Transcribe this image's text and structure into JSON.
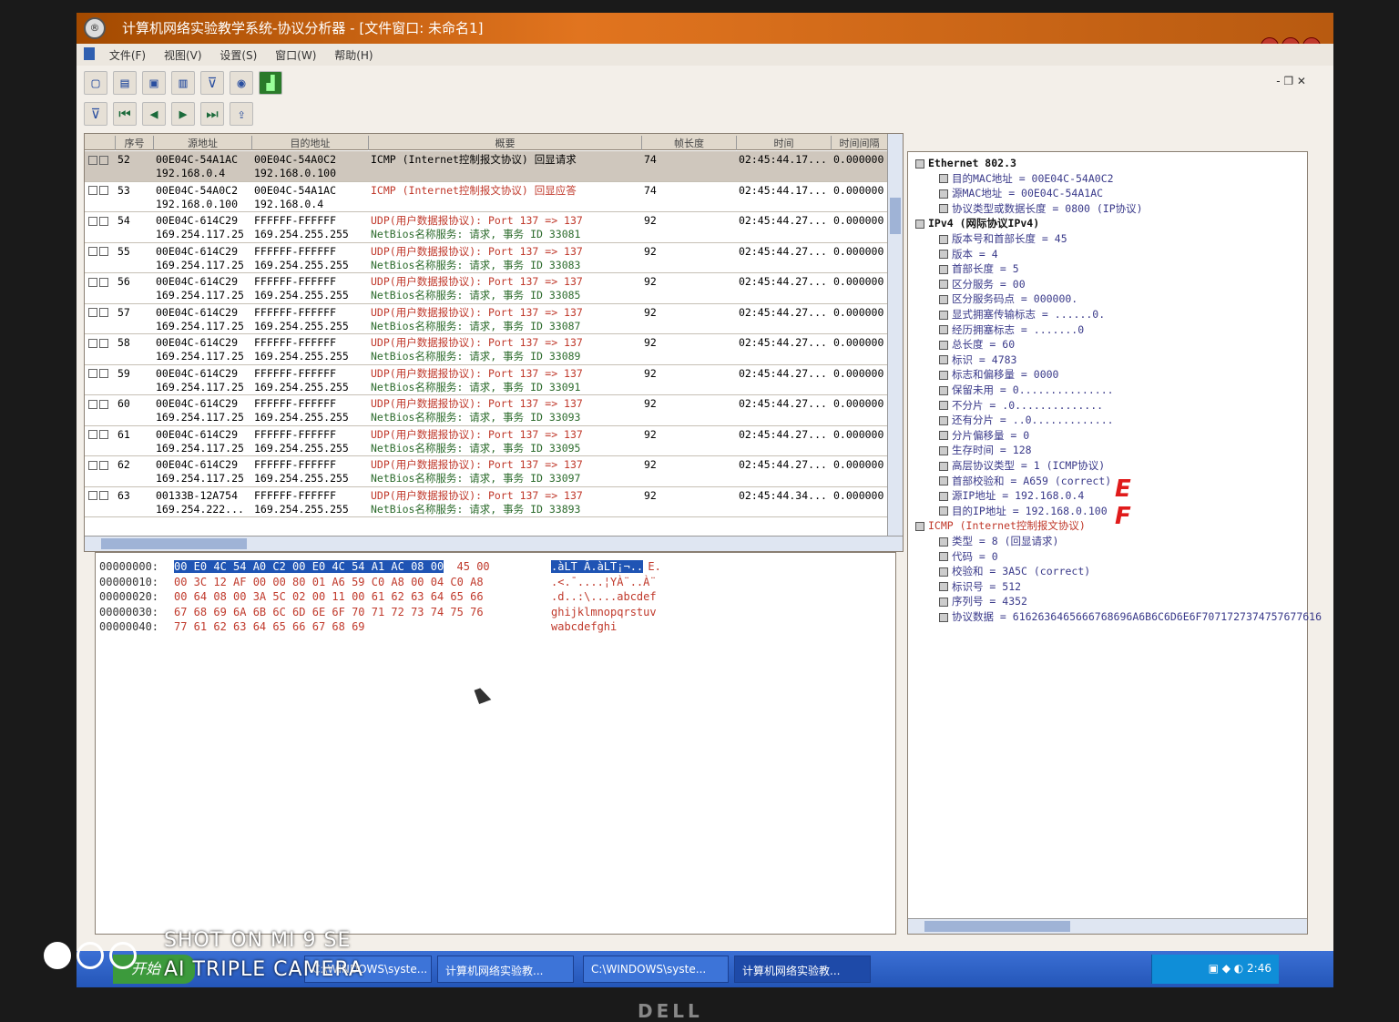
{
  "window": {
    "title": "计算机网络实验教学系统-协议分析器 - [文件窗口: 未命名1]"
  },
  "menu": [
    "文件(F)",
    "视图(V)",
    "设置(S)",
    "窗口(W)",
    "帮助(H)"
  ],
  "packet_list": {
    "columns": [
      "序号",
      "源地址",
      "目的地址",
      "概要",
      "帧长度",
      "时间",
      "时间间隔"
    ],
    "rows": [
      {
        "no": "52",
        "src1": "00E04C-54A1AC",
        "src2": "192.168.0.4",
        "dst1": "00E04C-54A0C2",
        "dst2": "192.168.0.100",
        "sum1": "ICMP (Internet控制报文协议) 回显请求",
        "sum2": "",
        "len": "74",
        "time": "02:45:44.17...",
        "gap": "0.000000"
      },
      {
        "no": "53",
        "src1": "00E04C-54A0C2",
        "src2": "192.168.0.100",
        "dst1": "00E04C-54A1AC",
        "dst2": "192.168.0.4",
        "sum1": "ICMP (Internet控制报文协议) 回显应答",
        "sum2": "",
        "len": "74",
        "time": "02:45:44.17...",
        "gap": "0.000000"
      },
      {
        "no": "54",
        "src1": "00E04C-614C29",
        "src2": "169.254.117.25",
        "dst1": "FFFFFF-FFFFFF",
        "dst2": "169.254.255.255",
        "sum1": "UDP(用户数据报协议): Port 137 => 137",
        "sum2": "NetBios名称服务: 请求, 事务 ID 33081",
        "len": "92",
        "time": "02:45:44.27...",
        "gap": "0.000000"
      },
      {
        "no": "55",
        "src1": "00E04C-614C29",
        "src2": "169.254.117.25",
        "dst1": "FFFFFF-FFFFFF",
        "dst2": "169.254.255.255",
        "sum1": "UDP(用户数据报协议): Port 137 => 137",
        "sum2": "NetBios名称服务: 请求, 事务 ID 33083",
        "len": "92",
        "time": "02:45:44.27...",
        "gap": "0.000000"
      },
      {
        "no": "56",
        "src1": "00E04C-614C29",
        "src2": "169.254.117.25",
        "dst1": "FFFFFF-FFFFFF",
        "dst2": "169.254.255.255",
        "sum1": "UDP(用户数据报协议): Port 137 => 137",
        "sum2": "NetBios名称服务: 请求, 事务 ID 33085",
        "len": "92",
        "time": "02:45:44.27...",
        "gap": "0.000000"
      },
      {
        "no": "57",
        "src1": "00E04C-614C29",
        "src2": "169.254.117.25",
        "dst1": "FFFFFF-FFFFFF",
        "dst2": "169.254.255.255",
        "sum1": "UDP(用户数据报协议): Port 137 => 137",
        "sum2": "NetBios名称服务: 请求, 事务 ID 33087",
        "len": "92",
        "time": "02:45:44.27...",
        "gap": "0.000000"
      },
      {
        "no": "58",
        "src1": "00E04C-614C29",
        "src2": "169.254.117.25",
        "dst1": "FFFFFF-FFFFFF",
        "dst2": "169.254.255.255",
        "sum1": "UDP(用户数据报协议): Port 137 => 137",
        "sum2": "NetBios名称服务: 请求, 事务 ID 33089",
        "len": "92",
        "time": "02:45:44.27...",
        "gap": "0.000000"
      },
      {
        "no": "59",
        "src1": "00E04C-614C29",
        "src2": "169.254.117.25",
        "dst1": "FFFFFF-FFFFFF",
        "dst2": "169.254.255.255",
        "sum1": "UDP(用户数据报协议): Port 137 => 137",
        "sum2": "NetBios名称服务: 请求, 事务 ID 33091",
        "len": "92",
        "time": "02:45:44.27...",
        "gap": "0.000000"
      },
      {
        "no": "60",
        "src1": "00E04C-614C29",
        "src2": "169.254.117.25",
        "dst1": "FFFFFF-FFFFFF",
        "dst2": "169.254.255.255",
        "sum1": "UDP(用户数据报协议): Port 137 => 137",
        "sum2": "NetBios名称服务: 请求, 事务 ID 33093",
        "len": "92",
        "time": "02:45:44.27...",
        "gap": "0.000000"
      },
      {
        "no": "61",
        "src1": "00E04C-614C29",
        "src2": "169.254.117.25",
        "dst1": "FFFFFF-FFFFFF",
        "dst2": "169.254.255.255",
        "sum1": "UDP(用户数据报协议): Port 137 => 137",
        "sum2": "NetBios名称服务: 请求, 事务 ID 33095",
        "len": "92",
        "time": "02:45:44.27...",
        "gap": "0.000000"
      },
      {
        "no": "62",
        "src1": "00E04C-614C29",
        "src2": "169.254.117.25",
        "dst1": "FFFFFF-FFFFFF",
        "dst2": "169.254.255.255",
        "sum1": "UDP(用户数据报协议): Port 137 => 137",
        "sum2": "NetBios名称服务: 请求, 事务 ID 33097",
        "len": "92",
        "time": "02:45:44.27...",
        "gap": "0.000000"
      },
      {
        "no": "63",
        "src1": "00133B-12A754",
        "src2": "169.254.222...",
        "dst1": "FFFFFF-FFFFFF",
        "dst2": "169.254.255.255",
        "sum1": "UDP(用户数据报协议): Port 137 => 137",
        "sum2": "NetBios名称服务: 请求, 事务 ID 33893",
        "len": "92",
        "time": "02:45:44.34...",
        "gap": "0.000000"
      }
    ]
  },
  "tree": [
    {
      "text": "Ethernet 802.3",
      "kind": "head"
    },
    {
      "text": "目的MAC地址 = 00E04C-54A0C2",
      "kind": "leaf"
    },
    {
      "text": "源MAC地址 = 00E04C-54A1AC",
      "kind": "leaf"
    },
    {
      "text": "协议类型或数据长度 = 0800 (IP协议)",
      "kind": "leaf"
    },
    {
      "text": "IPv4 (网际协议IPv4)",
      "kind": "head"
    },
    {
      "text": "版本号和首部长度 = 45",
      "kind": "leaf"
    },
    {
      "text": "版本 = 4",
      "kind": "leaf"
    },
    {
      "text": "首部长度 = 5",
      "kind": "leaf"
    },
    {
      "text": "区分服务 = 00",
      "kind": "leaf"
    },
    {
      "text": "区分服务码点 = 000000.",
      "kind": "leaf"
    },
    {
      "text": "显式拥塞传输标志 = ......0.",
      "kind": "leaf"
    },
    {
      "text": "经历拥塞标志 = .......0",
      "kind": "leaf"
    },
    {
      "text": "总长度 = 60",
      "kind": "leaf"
    },
    {
      "text": "标识 = 4783",
      "kind": "leaf"
    },
    {
      "text": "标志和偏移量 = 0000",
      "kind": "leaf"
    },
    {
      "text": "保留未用 = 0...............",
      "kind": "leaf"
    },
    {
      "text": "不分片 = .0..............",
      "kind": "leaf"
    },
    {
      "text": "还有分片 = ..0.............",
      "kind": "leaf"
    },
    {
      "text": "分片偏移量 = 0",
      "kind": "leaf"
    },
    {
      "text": "生存时间 = 128",
      "kind": "leaf"
    },
    {
      "text": "高层协议类型 = 1 (ICMP协议)",
      "kind": "leaf"
    },
    {
      "text": "首部校验和 = A659 (correct)",
      "kind": "leaf"
    },
    {
      "text": "源IP地址 = 192.168.0.4",
      "kind": "leaf"
    },
    {
      "text": "目的IP地址 = 192.168.0.100",
      "kind": "leaf"
    },
    {
      "text": "ICMP (Internet控制报文协议)",
      "kind": "icmp"
    },
    {
      "text": "类型 = 8 (回显请求)",
      "kind": "leaf"
    },
    {
      "text": "代码 = 0",
      "kind": "leaf"
    },
    {
      "text": "校验和 = 3A5C (correct)",
      "kind": "leaf"
    },
    {
      "text": "标识号 = 512",
      "kind": "leaf"
    },
    {
      "text": "序列号 = 4352",
      "kind": "leaf"
    },
    {
      "text": "协议数据 = 6162636465666768696A6B6C6D6E6F7071727374757677616",
      "kind": "leaf"
    }
  ],
  "hex": [
    {
      "off": "00000000:",
      "sel": "00 E0 4C 54 A0 C2 00 E0 4C 54 A1 AC 08 00",
      "rest": " 45 00",
      "asc_sel": ".àLT Â.àLT¡¬..",
      "asc_rest": "E."
    },
    {
      "off": "00000010:",
      "sel": "",
      "rest": "00 3C 12 AF 00 00 80 01 A6 59 C0 A8 00 04 C0 A8",
      "asc_sel": "",
      "asc_rest": ".<.¯....¦YÀ¨..À¨"
    },
    {
      "off": "00000020:",
      "sel": "",
      "rest": "00 64 08 00 3A 5C 02 00 11 00 61 62 63 64 65 66",
      "asc_sel": "",
      "asc_rest": ".d..:\\....abcdef"
    },
    {
      "off": "00000030:",
      "sel": "",
      "rest": "67 68 69 6A 6B 6C 6D 6E 6F 70 71 72 73 74 75 76",
      "asc_sel": "",
      "asc_rest": "ghijklmnopqrstuv"
    },
    {
      "off": "00000040:",
      "sel": "",
      "rest": "77 61 62 63 64 65 66 67 68 69",
      "asc_sel": "",
      "asc_rest": "wabcdefghi"
    }
  ],
  "annotation": "E\nF",
  "taskbar": {
    "start": "开始",
    "tasks": [
      "C:\\WINDOWS\\syste...",
      "计算机网络实验教...",
      "C:\\WINDOWS\\syste...",
      "计算机网络实验教..."
    ],
    "clock": "2:46"
  },
  "watermark": {
    "line1": "SHOT ON MI 9 SE",
    "line2": "AI TRIPLE CAMERA"
  },
  "monitor_brand": "DELL"
}
